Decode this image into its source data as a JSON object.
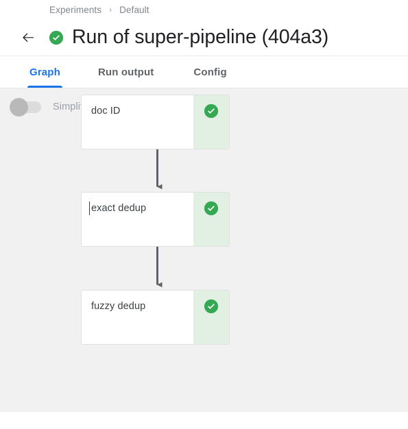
{
  "breadcrumb": {
    "items": [
      "Experiments",
      "Default"
    ],
    "separator": "›"
  },
  "header": {
    "back_icon": "arrow-left-icon",
    "status_icon": "check-circle-icon",
    "status_color": "#34a853",
    "title": "Run of super-pipeline (404a3)"
  },
  "tabs": [
    {
      "label": "Graph",
      "active": true
    },
    {
      "label": "Run output",
      "active": false
    },
    {
      "label": "Config",
      "active": false
    }
  ],
  "controls": {
    "simplify_toggle": {
      "label": "Simplify Graph",
      "state": "off"
    }
  },
  "graph": {
    "background_color": "#f1f1f1",
    "edge_color": "#5f6368",
    "status_strip_color": "#e2f0e4",
    "nodes": [
      {
        "label": "doc ID",
        "status_icon": "check-circle-icon",
        "status": "succeeded",
        "caret": false
      },
      {
        "label": "exact dedup",
        "status_icon": "check-circle-icon",
        "status": "succeeded",
        "caret": true
      },
      {
        "label": "fuzzy dedup",
        "status_icon": "check-circle-icon",
        "status": "succeeded",
        "caret": false
      }
    ],
    "edges": [
      {
        "from": "doc ID",
        "to": "exact dedup"
      },
      {
        "from": "exact dedup",
        "to": "fuzzy dedup"
      }
    ]
  }
}
